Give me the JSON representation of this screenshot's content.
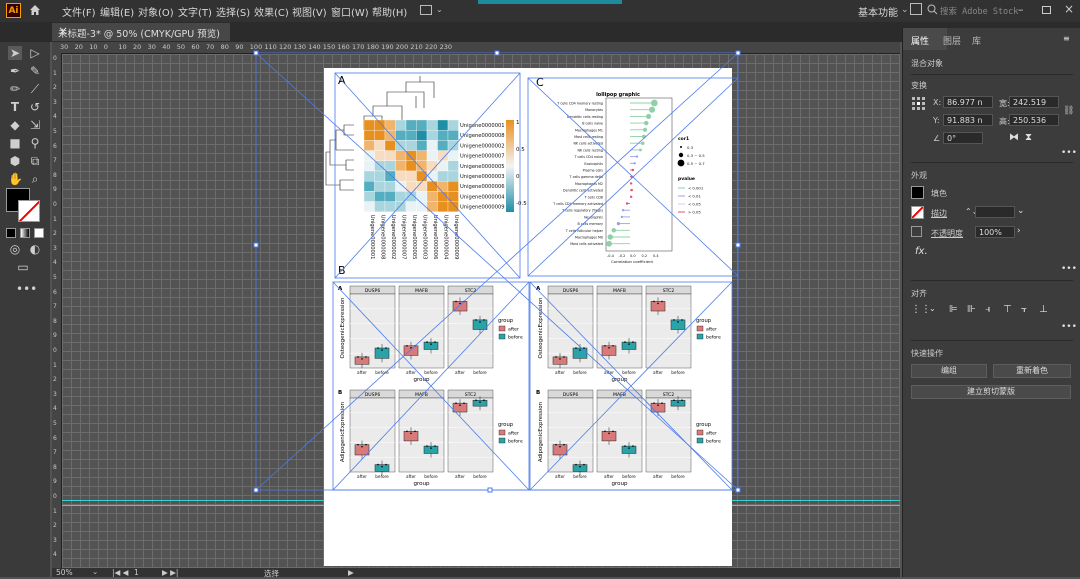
{
  "app": {
    "logo": "Ai",
    "workspace": "基本功能",
    "search_placeholder": "搜索 Adobe Stock"
  },
  "menu": [
    "文件(F)",
    "编辑(E)",
    "对象(O)",
    "文字(T)",
    "选择(S)",
    "效果(C)",
    "视图(V)",
    "窗口(W)",
    "帮助(H)"
  ],
  "document_tab": {
    "title": "未标题-3* @ 50% (CMYK/GPU 预览)",
    "close": "×"
  },
  "ruler_top": [
    "30",
    "20",
    "10",
    "0",
    "10",
    "20",
    "30",
    "40",
    "50",
    "60",
    "70",
    "80",
    "90",
    "100",
    "110",
    "120",
    "130",
    "140",
    "150",
    "160",
    "170",
    "180",
    "190",
    "200",
    "210",
    "220",
    "230"
  ],
  "ruler_left": [
    "0",
    "1",
    "2",
    "3",
    "4",
    "5",
    "6",
    "7",
    "8",
    "9",
    "0",
    "1",
    "2",
    "3",
    "4",
    "5",
    "6",
    "7",
    "8",
    "9",
    "0",
    "1",
    "2",
    "3",
    "4",
    "5",
    "6",
    "7",
    "8",
    "9",
    "0",
    "1",
    "2",
    "3",
    "4"
  ],
  "status": {
    "zoom": "50%",
    "artboard": "1",
    "mode": "选择"
  },
  "panel": {
    "tabs": [
      "属性",
      "图层",
      "库"
    ],
    "object_type": "混合对象",
    "transform_title": "变换",
    "x_label": "X:",
    "x": "86.977 n",
    "y_label": "Y:",
    "y": "91.883 n",
    "w_label": "宽:",
    "w": "242.519",
    "h_label": "高:",
    "h": "250.536",
    "angle": "0°",
    "appearance_title": "外观",
    "fill_label": "填色",
    "stroke_label": "描边",
    "opacity_label": "不透明度",
    "opacity": "100%",
    "fx": "fx.",
    "align_title": "对齐",
    "quick_title": "快速操作",
    "btn_group": "编组",
    "btn_recolor": "重新着色",
    "btn_clip": "建立剪切蒙版"
  },
  "figure": {
    "panel_labels": [
      "A",
      "B",
      "C"
    ],
    "heatmap_genes": [
      "Unigene0000001",
      "Unigene0000008",
      "Unigene0000002",
      "Unigene0000007",
      "Unigene0000005",
      "Unigene0000003",
      "Unigene0000006",
      "Unigene0000004",
      "Unigene0000009"
    ],
    "heatmap_scale": [
      "1",
      "0.5",
      "0",
      "-0.5"
    ],
    "lollipop_title": "lollipop graphic",
    "lollipop_xlabel": "Correlation coefficient",
    "lollipop_cells": [
      "T cells CD4 memory resting",
      "Monocytes",
      "Dendritic cells resting",
      "B cells naive",
      "Macrophages M1",
      "Mast cells resting",
      "NK cells activated",
      "NK cells resting",
      "T cells CD4 naive",
      "Eosinophils",
      "Plasma cells",
      "T cells gamma delta",
      "Macrophages M2",
      "Dendritic cells activated",
      "T cells CD8",
      "T cells CD4 memory activated",
      "T cells regulatory (Tregs)",
      "Neutrophils",
      "B cells memory",
      "T cells follicular helper",
      "Macrophages M0",
      "Mast cells activated"
    ],
    "lollipop_legend": {
      "cor_title": "cor1",
      "cor": [
        "0.3",
        "0.3 ~ 0.5",
        "0.5 ~ 0.7"
      ],
      "p_title": "pvalue",
      "p": [
        "< 0.001",
        "< 0.01",
        "< 0.05",
        "> 0.05"
      ]
    },
    "lollipop_ticks": [
      "-0.4",
      "-0.2",
      "0.0",
      "0.2",
      "0.4"
    ],
    "box_sub": [
      "A",
      "B"
    ],
    "box_genes": [
      "DUSP6",
      "MAFB",
      "STC2"
    ],
    "box_ylabels": [
      "OsteogenicExpression",
      "AdipogenicExpression"
    ],
    "box_xlabel": "group",
    "box_groups": [
      "after",
      "before"
    ],
    "legend_title": "group"
  },
  "colors": {
    "ai_orange": "#ff9a00",
    "selection": "#4b7bec",
    "heat_high": "#e8901f",
    "heat_low": "#1f8fa8",
    "after": "#d77a7a",
    "before": "#2aa3a8"
  }
}
